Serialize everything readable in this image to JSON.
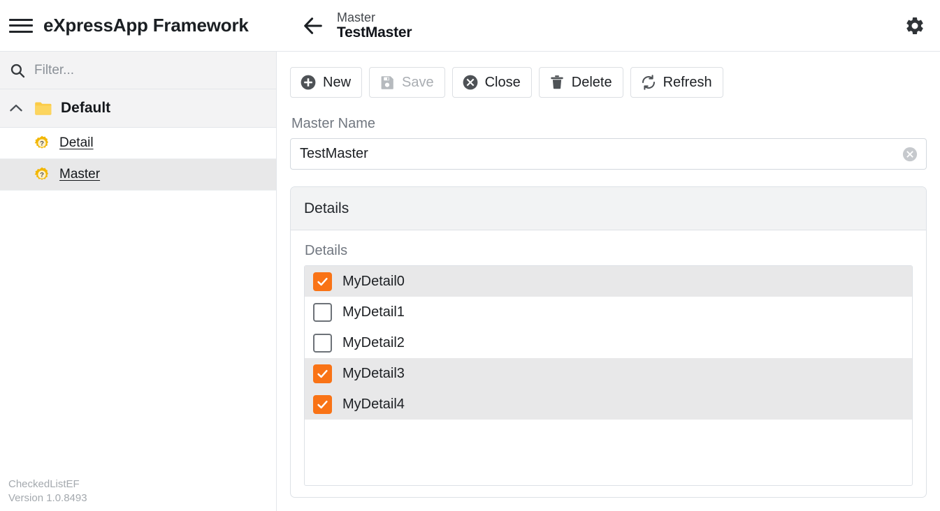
{
  "topbar": {
    "menu_icon": "hamburger-icon",
    "brand": "eXpressApp Framework",
    "back_icon": "arrow-left-icon",
    "subtitle": "Master",
    "title": "TestMaster",
    "settings_icon": "gear-icon"
  },
  "sidebar": {
    "filter": {
      "icon": "search-icon",
      "value": "",
      "placeholder": "Filter..."
    },
    "group": {
      "chevron_icon": "chevron-up-icon",
      "folder_icon": "folder-icon",
      "label": "Default"
    },
    "items": [
      {
        "label": "Detail",
        "icon": "gear-question-icon",
        "selected": false
      },
      {
        "label": "Master",
        "icon": "gear-question-icon",
        "selected": true
      }
    ],
    "footer": {
      "app_name": "CheckedListEF",
      "version": "Version 1.0.8493"
    }
  },
  "main": {
    "toolbar": [
      {
        "label": "New",
        "icon": "plus-circle-icon",
        "disabled": false
      },
      {
        "label": "Save",
        "icon": "floppy-disk-icon",
        "disabled": true
      },
      {
        "label": "Close",
        "icon": "x-circle-icon",
        "disabled": false
      },
      {
        "label": "Delete",
        "icon": "trash-icon",
        "disabled": false
      },
      {
        "label": "Refresh",
        "icon": "refresh-icon",
        "disabled": false
      }
    ],
    "master_name": {
      "label": "Master Name",
      "value": "TestMaster",
      "placeholder": "",
      "clear_icon": "clear-circle-icon"
    },
    "details_panel": {
      "header": "Details",
      "list_label": "Details",
      "items": [
        {
          "label": "MyDetail0",
          "checked": true
        },
        {
          "label": "MyDetail1",
          "checked": false
        },
        {
          "label": "MyDetail2",
          "checked": false
        },
        {
          "label": "MyDetail3",
          "checked": true
        },
        {
          "label": "MyDetail4",
          "checked": true
        }
      ]
    }
  },
  "colors": {
    "accent_orange": "#f97316",
    "folder_yellow": "#fbcb46",
    "selected_row": "#e8e8e9",
    "panel_header": "#f2f3f4",
    "border": "#dde1e6"
  }
}
